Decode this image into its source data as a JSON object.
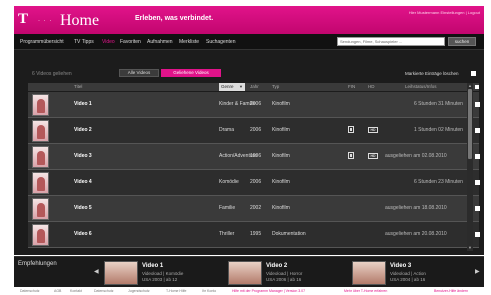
{
  "header": {
    "logo_t": "T",
    "logo_dots": "· · ·",
    "logo_home": "Home",
    "tagline": "Erleben, was verbindet.",
    "user_info": "Hier Mustermann  Einstellungen | Logout"
  },
  "nav": {
    "items": [
      "Programmübersicht",
      "TV Tipps",
      "Video",
      "Favoriten",
      "Aufnahmen",
      "Merkliste",
      "Suchagenten"
    ],
    "active": "Video",
    "search_placeholder": "Sendungen, Filme, Schauspieler ...",
    "search_button": "suchen"
  },
  "main": {
    "count_text": "6 Videos geliehen",
    "filter_all": "Alle Videos",
    "filter_loaned": "Geliehene Videos",
    "mark_label": "Markierte Einträge löschen",
    "columns": {
      "title": "Titel",
      "genre": "Genre",
      "year": "Jahr",
      "type": "Typ",
      "fin": "FIN",
      "hd": "HD",
      "loan_status": "Leihstatus/Infos"
    },
    "rows": [
      {
        "title": "Video 1",
        "genre": "Kinder & Familie",
        "year": "2006",
        "type": "Kinofilm",
        "fin": false,
        "hd": false,
        "status": "6 Stunden 31 Minuten"
      },
      {
        "title": "Video 2",
        "genre": "Drama",
        "year": "2006",
        "type": "Kinofilm",
        "fin": true,
        "hd": true,
        "status": "1 Stunden 02 Minuten"
      },
      {
        "title": "Video 3",
        "genre": "Action/Adventure",
        "year": "1996",
        "type": "Kinofilm",
        "fin": true,
        "hd": true,
        "status": "ausgeliehen am 02.08.2010"
      },
      {
        "title": "Video 4",
        "genre": "Komödie",
        "year": "2006",
        "type": "Kinofilm",
        "fin": false,
        "hd": false,
        "status": "6 Stunden 23 Minuten"
      },
      {
        "title": "Video 5",
        "genre": "Familie",
        "year": "2002",
        "type": "Kinofilm",
        "fin": false,
        "hd": false,
        "status": "ausgeliehen am 18.08.2010"
      },
      {
        "title": "Video 6",
        "genre": "Thriller",
        "year": "1995",
        "type": "Dokumentation",
        "fin": false,
        "hd": false,
        "status": "ausgeliehen am 20.08.2010"
      }
    ]
  },
  "recommendations": {
    "label": "Empfehlungen",
    "prev": "◀",
    "next": "▶",
    "items": [
      {
        "title": "Video 1",
        "sub": "Videoload | Komödie",
        "sub2": "USA 2003 | ab 12"
      },
      {
        "title": "Video 2",
        "sub": "Videoload | Horror",
        "sub2": "USA 2006 | ab 16"
      },
      {
        "title": "Video 3",
        "sub": "Videoload | Action",
        "sub2": "USA 2004 | ab 16"
      }
    ]
  },
  "footer": {
    "links": [
      "Datenschutz",
      "AGB",
      "Kontakt",
      "Datenschutz",
      "Jugendschutz",
      "T-Home Hilfe",
      "Ihr Konto"
    ],
    "pink1": "Hilfe mit der Programm Manager | Version 3.07",
    "pink2": "Mehr über T-Home erfahren",
    "pink3": "Benutzer-Hilfe ändern"
  },
  "colors": {
    "brand_magenta": "#e1138a",
    "background_dark": "#1c1c1c"
  }
}
